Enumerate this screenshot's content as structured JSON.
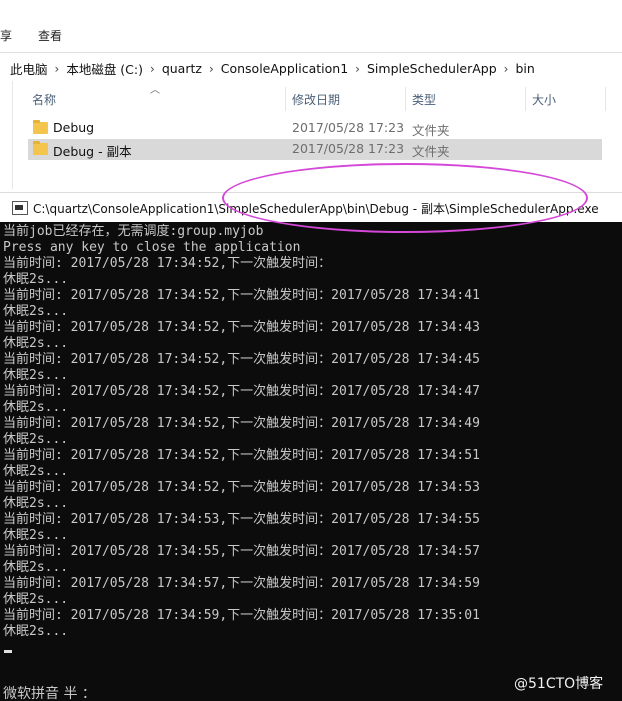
{
  "ribbon": {
    "tabs": [
      "享",
      "查看"
    ]
  },
  "address_bar": {
    "crumbs": [
      "此电脑",
      "本地磁盘 (C:)",
      "quartz",
      "ConsoleApplication1",
      "SimpleSchedulerApp",
      "bin"
    ]
  },
  "file_list": {
    "columns": [
      "名称",
      "修改日期",
      "类型",
      "大小"
    ],
    "rows": [
      {
        "name": "Debug",
        "date": "2017/05/28 17:23",
        "type": "文件夹",
        "selected": false
      },
      {
        "name": "Debug - 副本",
        "date": "2017/05/28 17:23",
        "type": "文件夹",
        "selected": true
      }
    ]
  },
  "console": {
    "title": "C:\\quartz\\ConsoleApplication1\\SimpleSchedulerApp\\bin\\Debug - 副本\\SimpleSchedulerApp.exe",
    "lines": [
      "当前job已经存在，无需调度:group.myjob",
      "Press any key to close the application",
      "当前时间: 2017/05/28 17:34:52,下一次触发时间：",
      "休眠2s...",
      "当前时间: 2017/05/28 17:34:52,下一次触发时间：2017/05/28 17:34:41",
      "休眠2s...",
      "当前时间: 2017/05/28 17:34:52,下一次触发时间：2017/05/28 17:34:43",
      "休眠2s...",
      "当前时间: 2017/05/28 17:34:52,下一次触发时间：2017/05/28 17:34:45",
      "休眠2s...",
      "当前时间: 2017/05/28 17:34:52,下一次触发时间：2017/05/28 17:34:47",
      "休眠2s...",
      "当前时间: 2017/05/28 17:34:52,下一次触发时间：2017/05/28 17:34:49",
      "休眠2s...",
      "当前时间: 2017/05/28 17:34:52,下一次触发时间：2017/05/28 17:34:51",
      "休眠2s...",
      "当前时间: 2017/05/28 17:34:52,下一次触发时间：2017/05/28 17:34:53",
      "休眠2s...",
      "当前时间: 2017/05/28 17:34:53,下一次触发时间：2017/05/28 17:34:55",
      "休眠2s...",
      "当前时间: 2017/05/28 17:34:55,下一次触发时间：2017/05/28 17:34:57",
      "休眠2s...",
      "当前时间: 2017/05/28 17:34:57,下一次触发时间：2017/05/28 17:34:59",
      "休眠2s...",
      "当前时间: 2017/05/28 17:34:59,下一次触发时间：2017/05/28 17:35:01",
      "休眠2s..."
    ],
    "ime_status": "微软拼音 半 ：",
    "watermark": "@51CTO博客"
  },
  "colors": {
    "console_bg": "#0c0c0c",
    "console_text": "#c8c8c8",
    "highlight": "#d547d8",
    "folder": "#f3c54c",
    "selected_row": "#d9d9d9"
  },
  "icons": [
    "folder-icon",
    "console-app-icon",
    "chevron-right-icon",
    "sort-up-icon"
  ]
}
